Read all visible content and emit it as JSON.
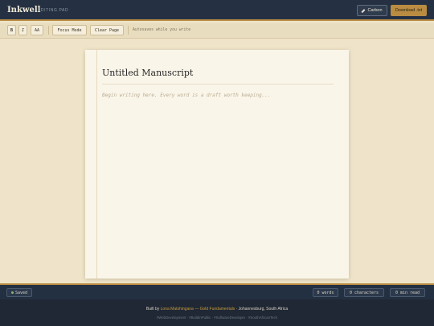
{
  "header": {
    "brand": "Inkwell",
    "subtitle": "EDITING PAD",
    "theme_button": "Carbon",
    "theme_icon": "pencil-icon",
    "download_button": "Download .txt"
  },
  "toolbar": {
    "bold": "B",
    "italic": "I",
    "font_size": "AA",
    "focus_mode": "Focus Mode",
    "clear_page": "Clear Page",
    "autosave_note": "Autosaves while you write"
  },
  "document": {
    "title": "Untitled Manuscript",
    "body_placeholder": "Begin writing here. Every word is a draft worth keeping..."
  },
  "status": {
    "saved": "Saved",
    "saved_icon": "dot-icon",
    "words": "0 words",
    "characters": "0 characters",
    "read_time": "0 min read"
  },
  "footer": {
    "built_by": "Built by",
    "author": "Lona Matshingana",
    "separator": "—",
    "company": "Gold Fundamentals",
    "location": "· Johannesburg, South Africa",
    "tags": "#WebDevelopment · #BuildInPublic · #SoftwareDeveloper · #SouthAfricanTech"
  },
  "colors": {
    "accent": "#b98c42",
    "header_bg": "#253142",
    "paper": "#faf5e9",
    "background": "#efe4c9"
  }
}
